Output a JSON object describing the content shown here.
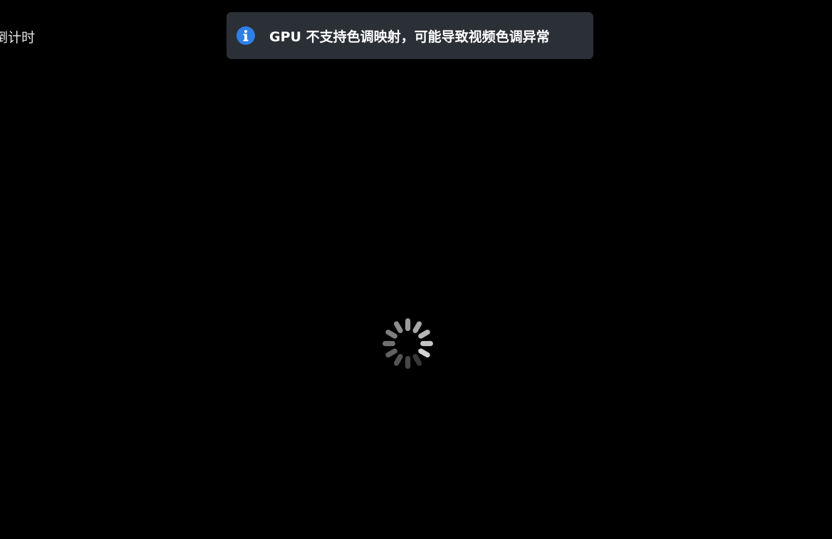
{
  "player": {
    "corner_label": "倒计时",
    "background_color": "#000000"
  },
  "toast": {
    "icon": "info-icon",
    "message": "GPU 不支持色调映射，可能导致视频色调异常",
    "icon_color": "#2f7fe6",
    "background_color": "#2b2f36"
  },
  "loading": {
    "icon": "loading-spinner-icon"
  }
}
